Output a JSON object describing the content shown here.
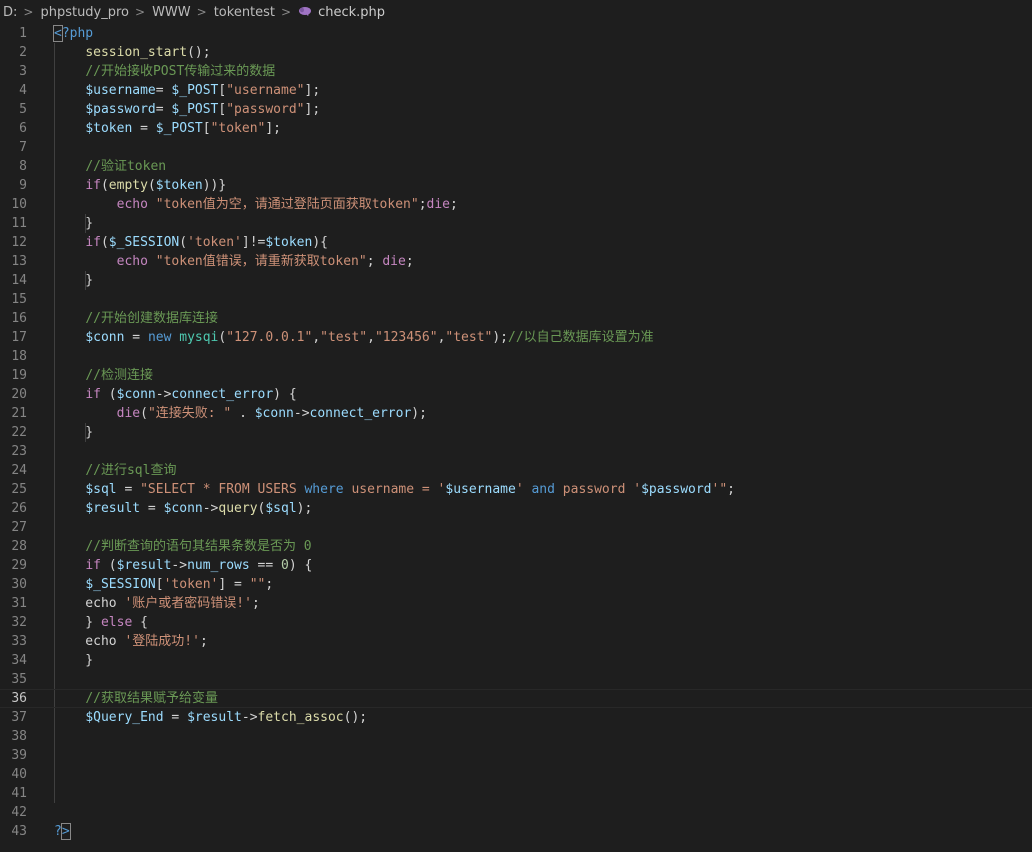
{
  "breadcrumb": {
    "items": [
      "D:",
      "phpstudy_pro",
      "WWW",
      "tokentest"
    ],
    "file": "check.php",
    "separator": ">",
    "file_icon": "php-elephant-icon"
  },
  "colors": {
    "background": "#1e1e1e",
    "keyword": "#569cd6",
    "control": "#c586c0",
    "string": "#ce9178",
    "variable": "#9cdcfe",
    "function": "#dcdcaa",
    "class": "#4ec9b0",
    "number": "#b5cea8",
    "comment": "#6a9955",
    "line_number": "#858585"
  },
  "editor": {
    "current_line": 36,
    "lines": [
      [
        [
          "kw",
          "<?php"
        ]
      ],
      [
        [
          "p",
          "    "
        ],
        [
          "fn",
          "session_start"
        ],
        [
          "p",
          "();"
        ]
      ],
      [
        [
          "p",
          "    "
        ],
        [
          "cmt",
          "//开始接收POST传输过来的数据"
        ]
      ],
      [
        [
          "p",
          "    "
        ],
        [
          "var",
          "$username"
        ],
        [
          "p",
          "= "
        ],
        [
          "var",
          "$_POST"
        ],
        [
          "p",
          "["
        ],
        [
          "str",
          "\"username\""
        ],
        [
          "p",
          "];"
        ]
      ],
      [
        [
          "p",
          "    "
        ],
        [
          "var",
          "$password"
        ],
        [
          "p",
          "= "
        ],
        [
          "var",
          "$_POST"
        ],
        [
          "p",
          "["
        ],
        [
          "str",
          "\"password\""
        ],
        [
          "p",
          "];"
        ]
      ],
      [
        [
          "p",
          "    "
        ],
        [
          "var",
          "$token"
        ],
        [
          "p",
          " = "
        ],
        [
          "var",
          "$_POST"
        ],
        [
          "p",
          "["
        ],
        [
          "str",
          "\"token\""
        ],
        [
          "p",
          "];"
        ]
      ],
      [],
      [
        [
          "p",
          "    "
        ],
        [
          "cmt",
          "//验证token"
        ]
      ],
      [
        [
          "p",
          "    "
        ],
        [
          "ctl",
          "if"
        ],
        [
          "p",
          "("
        ],
        [
          "fn",
          "empty"
        ],
        [
          "p",
          "("
        ],
        [
          "var",
          "$token"
        ],
        [
          "p",
          "))}"
        ]
      ],
      [
        [
          "p",
          "        "
        ],
        [
          "ctl",
          "echo"
        ],
        [
          "p",
          " "
        ],
        [
          "str",
          "\"token值为空，请通过登陆页面获取token\""
        ],
        [
          "p",
          ";"
        ],
        [
          "ctl",
          "die"
        ],
        [
          "p",
          ";"
        ]
      ],
      [
        [
          "p",
          "    }"
        ]
      ],
      [
        [
          "p",
          "    "
        ],
        [
          "ctl",
          "if"
        ],
        [
          "p",
          "("
        ],
        [
          "var",
          "$_SESSION"
        ],
        [
          "p",
          "("
        ],
        [
          "str",
          "'token'"
        ],
        [
          "p",
          "]!="
        ],
        [
          "var",
          "$token"
        ],
        [
          "p",
          "){"
        ]
      ],
      [
        [
          "p",
          "        "
        ],
        [
          "ctl",
          "echo"
        ],
        [
          "p",
          " "
        ],
        [
          "str",
          "\"token值错误，请重新获取token\""
        ],
        [
          "p",
          "; "
        ],
        [
          "ctl",
          "die"
        ],
        [
          "p",
          ";"
        ]
      ],
      [
        [
          "p",
          "    }"
        ]
      ],
      [],
      [
        [
          "p",
          "    "
        ],
        [
          "cmt",
          "//开始创建数据库连接"
        ]
      ],
      [
        [
          "p",
          "    "
        ],
        [
          "var",
          "$conn"
        ],
        [
          "p",
          " = "
        ],
        [
          "kw",
          "new"
        ],
        [
          "p",
          " "
        ],
        [
          "cls",
          "mysqi"
        ],
        [
          "p",
          "("
        ],
        [
          "str",
          "\"127.0.0.1\""
        ],
        [
          "p",
          ","
        ],
        [
          "str",
          "\"test\""
        ],
        [
          "p",
          ","
        ],
        [
          "str",
          "\"123456\""
        ],
        [
          "p",
          ","
        ],
        [
          "str",
          "\"test\""
        ],
        [
          "p",
          ");"
        ],
        [
          "cmt",
          "//以自己数据库设置为准"
        ]
      ],
      [],
      [
        [
          "p",
          "    "
        ],
        [
          "cmt",
          "//检测连接"
        ]
      ],
      [
        [
          "p",
          "    "
        ],
        [
          "ctl",
          "if"
        ],
        [
          "p",
          " ("
        ],
        [
          "var",
          "$conn"
        ],
        [
          "p",
          "->"
        ],
        [
          "var",
          "connect_error"
        ],
        [
          "p",
          ") {"
        ]
      ],
      [
        [
          "p",
          "        "
        ],
        [
          "ctl",
          "die"
        ],
        [
          "p",
          "("
        ],
        [
          "str",
          "\"连接失败: \""
        ],
        [
          "p",
          " . "
        ],
        [
          "var",
          "$conn"
        ],
        [
          "p",
          "->"
        ],
        [
          "var",
          "connect_error"
        ],
        [
          "p",
          ");"
        ]
      ],
      [
        [
          "p",
          "    }"
        ]
      ],
      [],
      [
        [
          "p",
          "    "
        ],
        [
          "cmt",
          "//进行sql查询"
        ]
      ],
      [
        [
          "p",
          "    "
        ],
        [
          "var",
          "$sql"
        ],
        [
          "p",
          " = "
        ],
        [
          "str",
          "\"SELECT * FROM USERS "
        ],
        [
          "kw",
          "where"
        ],
        [
          "str",
          " username = '"
        ],
        [
          "var",
          "$username"
        ],
        [
          "str",
          "' "
        ],
        [
          "kw",
          "and"
        ],
        [
          "str",
          " password '"
        ],
        [
          "var",
          "$password"
        ],
        [
          "str",
          "'\""
        ],
        [
          "p",
          ";"
        ]
      ],
      [
        [
          "p",
          "    "
        ],
        [
          "var",
          "$result"
        ],
        [
          "p",
          " = "
        ],
        [
          "var",
          "$conn"
        ],
        [
          "p",
          "->"
        ],
        [
          "fn",
          "query"
        ],
        [
          "p",
          "("
        ],
        [
          "var",
          "$sql"
        ],
        [
          "p",
          ");"
        ]
      ],
      [],
      [
        [
          "p",
          "    "
        ],
        [
          "cmt",
          "//判断查询的语句其结果条数是否为 0"
        ]
      ],
      [
        [
          "p",
          "    "
        ],
        [
          "ctl",
          "if"
        ],
        [
          "p",
          " ("
        ],
        [
          "var",
          "$result"
        ],
        [
          "p",
          "->"
        ],
        [
          "var",
          "num_rows"
        ],
        [
          "p",
          " == "
        ],
        [
          "num",
          "0"
        ],
        [
          "p",
          ") {"
        ]
      ],
      [
        [
          "p",
          "    "
        ],
        [
          "var",
          "$_SESSION"
        ],
        [
          "p",
          "["
        ],
        [
          "str",
          "'token'"
        ],
        [
          "p",
          "] = "
        ],
        [
          "str",
          "\"\""
        ],
        [
          "p",
          ";"
        ]
      ],
      [
        [
          "p",
          "    echo "
        ],
        [
          "str",
          "'账户或者密码错误!'"
        ],
        [
          "p",
          ";"
        ]
      ],
      [
        [
          "p",
          "    } "
        ],
        [
          "ctl",
          "else"
        ],
        [
          "p",
          " {"
        ]
      ],
      [
        [
          "p",
          "    echo "
        ],
        [
          "str",
          "'登陆成功!'"
        ],
        [
          "p",
          ";"
        ]
      ],
      [
        [
          "p",
          "    }"
        ]
      ],
      [],
      [
        [
          "p",
          "    "
        ],
        [
          "cmt",
          "//获取结果赋予给变量"
        ]
      ],
      [
        [
          "p",
          "    "
        ],
        [
          "var",
          "$Query_End"
        ],
        [
          "p",
          " = "
        ],
        [
          "var",
          "$result"
        ],
        [
          "p",
          "->"
        ],
        [
          "fn",
          "fetch_assoc"
        ],
        [
          "p",
          "();"
        ]
      ],
      [],
      [],
      [],
      [],
      [],
      [
        [
          "kw",
          "?>"
        ]
      ]
    ]
  }
}
